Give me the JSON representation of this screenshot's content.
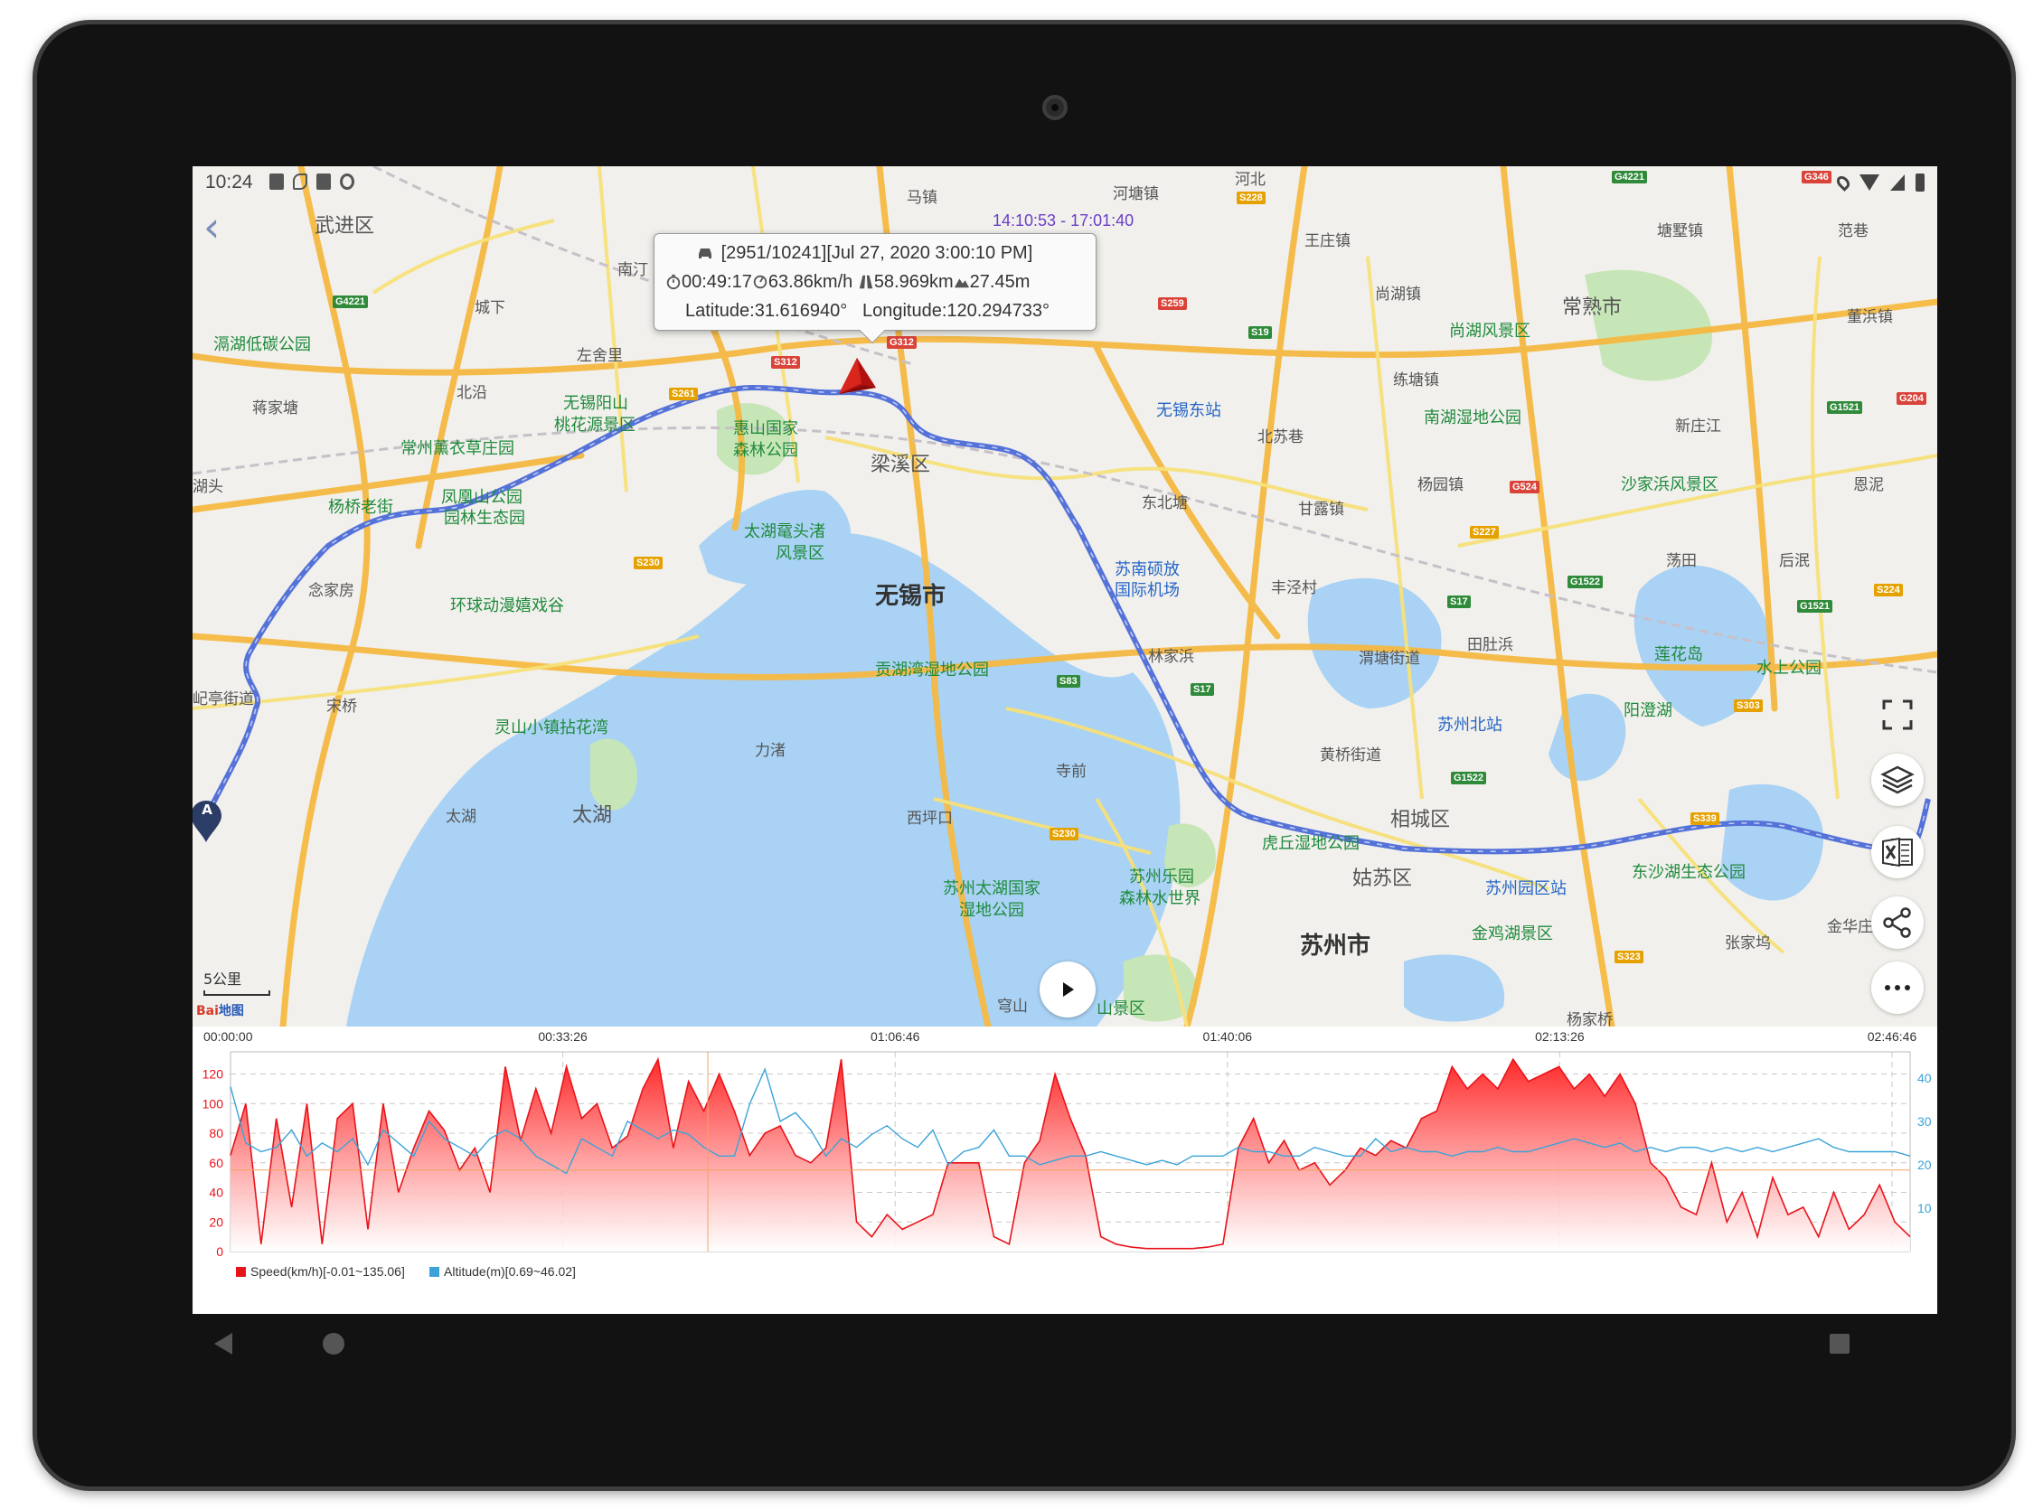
{
  "status_bar": {
    "time": "10:24"
  },
  "time_range": "14:10:53 - 17:01:40",
  "popup": {
    "line1": "[2951/10241][Jul 27, 2020 3:00:10 PM]",
    "duration": "00:49:17",
    "speed": "63.86km/h",
    "distance": "58.969km",
    "altitude": "27.45m",
    "latitude": "Latitude:31.616940°",
    "longitude": "Longitude:120.294733°"
  },
  "map": {
    "scale_label": "5公里",
    "logo_text": "Bai",
    "logo_text2": "地图",
    "start_marker": "A",
    "labels": {
      "wujin": "武进区",
      "majishan": "马镇",
      "hetang": "河塘镇",
      "hebei": "河北",
      "nanshi": "南汀",
      "chengxia": "城下",
      "zuohe": "左舍里",
      "beiyan": "北沿",
      "jiangjiatang": "蒋家塘",
      "gehu": "滆湖低碳公园",
      "wuxi_yangshan": "无锡阳山",
      "taohuayuan": "桃花源景区",
      "changzhou_xunyi": "常州薰衣草庄园",
      "huishan": "惠山国家",
      "huishan2": "森林公园",
      "liangxi": "梁溪区",
      "yangqiao": "杨桥老街",
      "fenghuangshan": "凤凰山公园",
      "yuanlin": "园林生态园",
      "taihuyuantou": "太湖鼋头渚",
      "taihuyuantou2": "风景区",
      "nianjia": "念家房",
      "huanqiu": "环球动漫嬉戏谷",
      "wuxi_city": "无锡市",
      "wuxi_east": "无锡东站",
      "dongbeitang": "东北塘",
      "beisujing": "北苏巷",
      "sunan": "苏南硕放",
      "sunan2": "国际机场",
      "fengjing": "丰泾村",
      "gongpu": "贡湖湾湿地公园",
      "lingshan": "灵山小镇拈花湾",
      "songqiao": "宋桥",
      "liuzhu": "力渚",
      "taihu": "太湖",
      "taihu_small": "太湖",
      "xikou": "西坪口",
      "suzhou_taihu": "苏州太湖国家",
      "suzhou_taihu2": "湿地公园",
      "suzhou_leyuan": "苏州乐园",
      "suzhou_leyuan2": "森林水世界",
      "huqiu": "虎丘湿地公园",
      "gusu": "姑苏区",
      "xiangcheng": "相城区",
      "suzhou_city": "苏州市",
      "suzhou_north": "苏州北站",
      "suzhou_yuanqu": "苏州园区站",
      "jinjihu": "金鸡湖景区",
      "dongsha": "东沙湖生态公园",
      "huangqiao": "黄桥街道",
      "wangzhuang": "王庄镇",
      "shanghu": "尚湖镇",
      "shanghu_scenic": "尚湖风景区",
      "changshu": "常熟市",
      "tangshi": "塘墅镇",
      "fanjing": "范巷",
      "lianshi": "练塘镇",
      "nanhu": "南湖湿地公园",
      "yangyuan": "杨园镇",
      "shajiabang": "沙家浜风景区",
      "xinzhuang": "新庄江",
      "dongbang": "董浜镇",
      "enli": "恩泥",
      "dangtian": "荡田",
      "houmo": "后泯",
      "lianhuadao": "莲花岛",
      "shuishang": "水上公园",
      "yangcheng": "阳澄湖",
      "weitang": "渭塘街道",
      "tiandu": "田肚浜",
      "ganlu": "甘露镇",
      "linjia": "林家浜",
      "sitiao": "寺前",
      "hutou": "湖头",
      "xiting": "屺亭街道",
      "zhangjia": "张家坞",
      "jinzhuang": "金华庄",
      "suzhou_shan": "穹山",
      "shanjingqu": "山景区",
      "yangjia": "杨家桥"
    }
  },
  "chart_data": {
    "type": "area",
    "x_tick_labels": [
      "00:00:00",
      "00:33:26",
      "01:06:46",
      "01:40:06",
      "02:13:26",
      "02:46:46"
    ],
    "left_axis": {
      "ticks": [
        0,
        20,
        40,
        60,
        80,
        100,
        120
      ],
      "range": [
        0,
        135
      ]
    },
    "right_axis": {
      "ticks": [
        10,
        20,
        30,
        40
      ],
      "range": [
        0,
        46
      ]
    },
    "legend": [
      "Speed(km/h)[-0.01~135.06]",
      "Altitude(m)[0.69~46.02]"
    ],
    "series": [
      {
        "name": "Speed(km/h)[-0.01~135.06]",
        "color": "#e8131a",
        "values": [
          65,
          100,
          5,
          90,
          30,
          100,
          5,
          90,
          100,
          15,
          100,
          40,
          70,
          95,
          82,
          55,
          70,
          40,
          125,
          75,
          110,
          80,
          125,
          90,
          100,
          70,
          78,
          110,
          130,
          70,
          115,
          95,
          120,
          95,
          65,
          80,
          85,
          65,
          60,
          70,
          130,
          20,
          10,
          25,
          15,
          20,
          25,
          60,
          60,
          60,
          10,
          5,
          60,
          75,
          120,
          90,
          65,
          10,
          5,
          3,
          2,
          2,
          2,
          2,
          3,
          5,
          70,
          90,
          60,
          75,
          55,
          60,
          45,
          55,
          70,
          65,
          75,
          70,
          90,
          95,
          125,
          110,
          120,
          110,
          130,
          115,
          120,
          125,
          110,
          120,
          105,
          120,
          100,
          60,
          50,
          30,
          25,
          60,
          20,
          40,
          10,
          50,
          25,
          30,
          10,
          40,
          15,
          25,
          45,
          20,
          10
        ]
      },
      {
        "name": "Altitude(m)[0.69~46.02]",
        "color": "#3ba3d8",
        "values": [
          38,
          25,
          23,
          24,
          28,
          22,
          25,
          23,
          26,
          20,
          28,
          25,
          22,
          30,
          26,
          24,
          22,
          26,
          28,
          26,
          22,
          20,
          18,
          26,
          24,
          22,
          30,
          28,
          26,
          28,
          27,
          24,
          22,
          22,
          34,
          42,
          30,
          32,
          28,
          22,
          26,
          24,
          27,
          29,
          26,
          24,
          28,
          20,
          23,
          24,
          28,
          22,
          22,
          20,
          21,
          22,
          22,
          23,
          22,
          21,
          20,
          21,
          20,
          22,
          22,
          22,
          24,
          23,
          23,
          22,
          22,
          24,
          23,
          22,
          22,
          26,
          23,
          24,
          23,
          23,
          22,
          23,
          23,
          24,
          23,
          23,
          24,
          25,
          26,
          25,
          24,
          25,
          23,
          24,
          23,
          24,
          24,
          23,
          24,
          23,
          24,
          23,
          24,
          25,
          26,
          24,
          23,
          23,
          23,
          23,
          22
        ]
      }
    ]
  }
}
